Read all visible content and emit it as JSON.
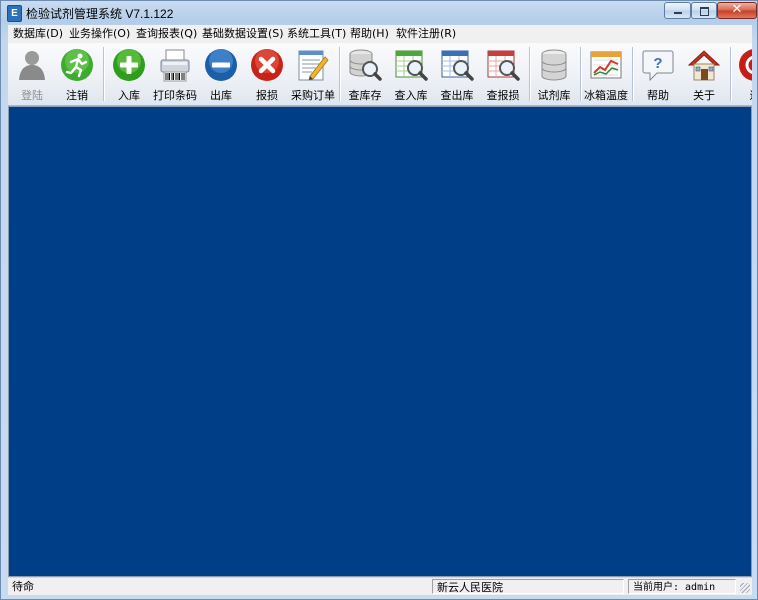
{
  "window": {
    "title": "检验试剂管理系统 V7.1.122",
    "app_icon_glyph": "E"
  },
  "menu": [
    "数据库(D)",
    "业务操作(O)",
    "查询报表(Q)",
    "基础数据设置(S)",
    "系统工具(T)",
    "帮助(H)",
    "软件注册(R)"
  ],
  "toolbar": {
    "buttons": [
      {
        "label": "登陆",
        "icon": "user-login-icon",
        "enabled": false
      },
      {
        "label": "注销",
        "icon": "logout-runner-icon",
        "enabled": true
      },
      {
        "label": "入库",
        "icon": "add-circle-icon",
        "enabled": true
      },
      {
        "label": "打印条码",
        "icon": "barcode-printer-icon",
        "enabled": true
      },
      {
        "label": "出库",
        "icon": "minus-circle-icon",
        "enabled": true
      },
      {
        "label": "报损",
        "icon": "x-circle-icon",
        "enabled": true
      },
      {
        "label": "采购订单",
        "icon": "purchase-order-icon",
        "enabled": true
      },
      {
        "label": "查库存",
        "icon": "search-database-icon",
        "enabled": true
      },
      {
        "label": "查入库",
        "icon": "search-green-table-icon",
        "enabled": true
      },
      {
        "label": "查出库",
        "icon": "search-blue-table-icon",
        "enabled": true
      },
      {
        "label": "查报损",
        "icon": "search-red-table-icon",
        "enabled": true
      },
      {
        "label": "试剂库",
        "icon": "database-icon",
        "enabled": true
      },
      {
        "label": "冰箱温度",
        "icon": "fridge-temperature-chart-icon",
        "enabled": true
      },
      {
        "label": "帮助",
        "icon": "help-bubble-icon",
        "enabled": true
      },
      {
        "label": "关于",
        "icon": "about-house-icon",
        "enabled": true
      },
      {
        "label": "退",
        "icon": "exit-power-icon",
        "enabled": true
      }
    ]
  },
  "status": {
    "message": "待命",
    "organization": "新云人民医院",
    "current_user": "当前用户: admin"
  },
  "colors": {
    "workspace": "#003f87",
    "accent": "#2f6fb8"
  }
}
